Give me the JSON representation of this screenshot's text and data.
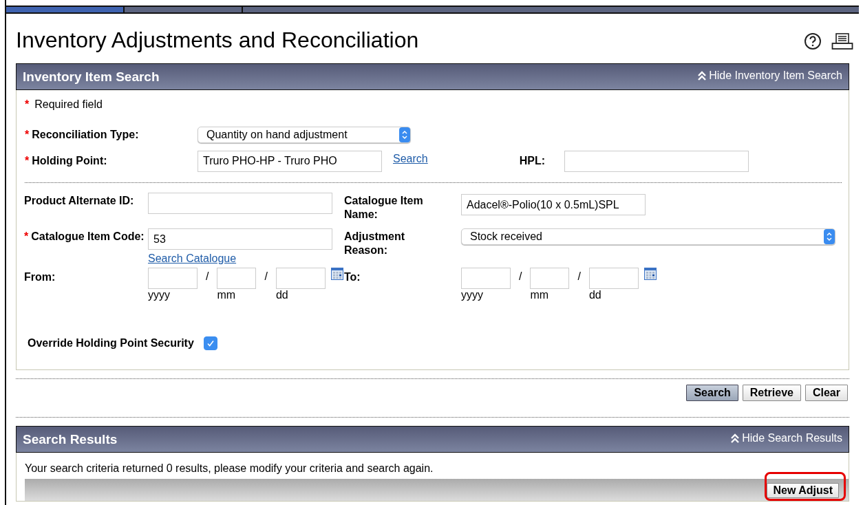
{
  "top_tabs": [
    {
      "selected": true
    },
    {
      "selected": false
    },
    {
      "selected": false
    }
  ],
  "title": "Inventory Adjustments and Reconciliation",
  "search_panel": {
    "title": "Inventory Item Search",
    "toggle": "Hide Inventory Item Search",
    "required_mark": "*",
    "required_note": "Required field",
    "reconciliation_type": {
      "label": "Reconciliation Type:",
      "required": true,
      "value": "Quantity on hand adjustment"
    },
    "holding_point": {
      "label": "Holding Point:",
      "required": true,
      "value": "Truro PHO-HP - Truro PHO",
      "link": "Search"
    },
    "hpl": {
      "label": "HPL:"
    },
    "product_alternate_id": {
      "label": "Product Alternate ID:",
      "required": false
    },
    "catalogue_item_name": {
      "label": "Catalogue Item Name:",
      "value": "Adacel®-Polio(10 x 0.5mL)SPL"
    },
    "catalogue_item_code": {
      "label": "Catalogue Item Code:",
      "required": true,
      "value": "53",
      "link": "Search Catalogue"
    },
    "adjustment_reason": {
      "label": "Adjustment Reason:",
      "value": "Stock received"
    },
    "date_ranges": [
      {
        "label": "From:",
        "separators": [
          "/",
          "/"
        ],
        "parts": [
          "yyyy",
          "mm",
          "dd"
        ]
      },
      {
        "label": "To:",
        "separators": [
          "/",
          "/"
        ],
        "parts": [
          "yyyy",
          "mm",
          "dd"
        ]
      }
    ],
    "override": {
      "label": "Override Holding Point Security",
      "checked": true
    }
  },
  "buttons": [
    {
      "label": "Search",
      "selected": true
    },
    {
      "label": "Retrieve",
      "selected": false
    },
    {
      "label": "Clear",
      "selected": false
    }
  ],
  "results_panel": {
    "title": "Search Results",
    "toggle": "Hide Search Results",
    "message": "Your search criteria returned 0 results, please modify your criteria and search again.",
    "new_adjust": {
      "label": "New Adjust",
      "highlighted": true
    }
  }
}
